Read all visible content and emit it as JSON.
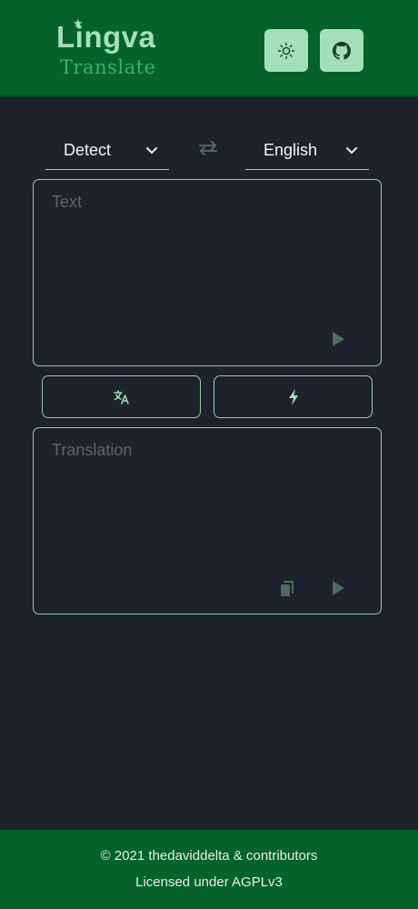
{
  "header": {
    "logo_top": "Lingva",
    "logo_bottom": "Translate",
    "theme_button_icon": "sun-icon",
    "github_button_icon": "github-icon"
  },
  "languages": {
    "source": "Detect",
    "target": "English",
    "swap_icon": "swap-icon"
  },
  "source_box": {
    "placeholder": "Text"
  },
  "actions": {
    "translate_icon": "translate-icon",
    "instant_icon": "lightning-icon"
  },
  "output_box": {
    "placeholder": "Translation"
  },
  "footer": {
    "line1": "© 2021 thedaviddelta & contributors",
    "line2": "Licensed under AGPLv3"
  },
  "colors": {
    "header_bg": "#04622a",
    "page_bg": "#1e222c",
    "accent_light": "#a3dfbb",
    "border": "#8fcfa8"
  }
}
